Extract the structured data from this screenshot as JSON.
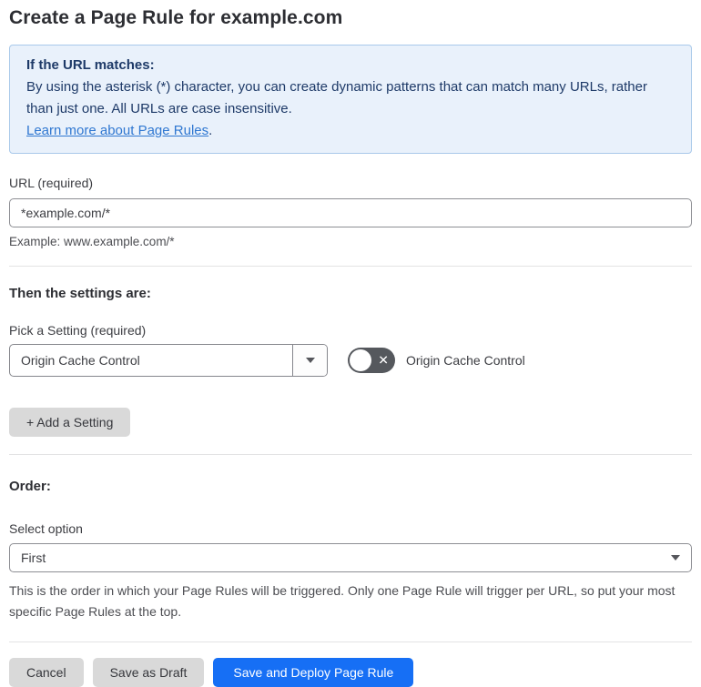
{
  "page": {
    "title": "Create a Page Rule for example.com"
  },
  "info_box": {
    "heading": "If the URL matches:",
    "body": "By using the asterisk (*) character, you can create dynamic patterns that can match many URLs, rather than just one. All URLs are case insensitive.",
    "link_label": "Learn more about Page Rules",
    "link_suffix": "."
  },
  "url_field": {
    "label": "URL (required)",
    "value": "*example.com/*",
    "helper": "Example: www.example.com/*"
  },
  "settings_section": {
    "heading": "Then the settings are:",
    "pick_label": "Pick a Setting (required)",
    "selected_setting": "Origin Cache Control",
    "toggle_state": "off",
    "toggle_icon": "✕",
    "toggle_label": "Origin Cache Control",
    "add_button_label": "+ Add a Setting"
  },
  "order_section": {
    "heading": "Order:",
    "select_label": "Select option",
    "selected_option": "First",
    "helper": "This is the order in which your Page Rules will be triggered. Only one Page Rule will trigger per URL, so put your most specific Page Rules at the top."
  },
  "footer": {
    "cancel_label": "Cancel",
    "save_draft_label": "Save as Draft",
    "save_deploy_label": "Save and Deploy Page Rule"
  },
  "colors": {
    "accent_blue": "#166ff5",
    "info_bg": "#e9f1fb",
    "info_border": "#a9c9ea",
    "info_text": "#1e3a68",
    "link_blue": "#2f77d1",
    "toggle_off_bg": "#55585d",
    "button_gray": "#d9d9d9"
  }
}
